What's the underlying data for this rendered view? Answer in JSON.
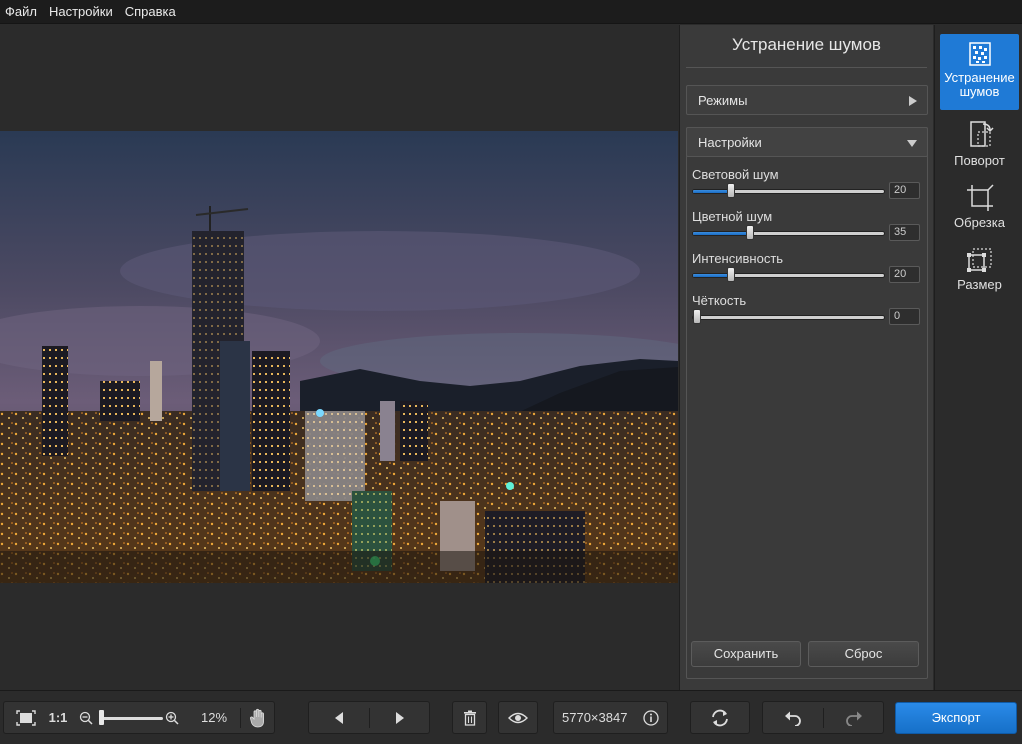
{
  "menu": [
    "Файл",
    "Настройки",
    "Справка"
  ],
  "panel": {
    "title": "Устранение шумов",
    "modes_label": "Режимы",
    "settings_label": "Настройки",
    "sliders": [
      {
        "label": "Световой шум",
        "value": "20",
        "level": 0.2
      },
      {
        "label": "Цветной шум",
        "value": "35",
        "level": 0.3
      },
      {
        "label": "Интенсивность",
        "value": "20",
        "level": 0.2
      },
      {
        "label": "Чёткость",
        "value": "0",
        "level": 0.0
      }
    ],
    "save_label": "Сохранить",
    "reset_label": "Сброс"
  },
  "tools": {
    "denoise": {
      "label": "Устранение шумов",
      "icon": "denoise-icon"
    },
    "rotate": {
      "label": "Поворот",
      "icon": "rotate-icon"
    },
    "crop": {
      "label": "Обрезка",
      "icon": "crop-icon"
    },
    "resize": {
      "label": "Размер",
      "icon": "resize-icon"
    }
  },
  "bottom": {
    "ratio_label": "1:1",
    "zoom_value": "12%",
    "zoom_level": 0.0,
    "dimensions": "5770×3847",
    "export_label": "Экспорт"
  },
  "colors": {
    "accent": "#1f7ad6",
    "panel_bg": "#3a3a3a",
    "app_bg": "#2b2b2b"
  }
}
